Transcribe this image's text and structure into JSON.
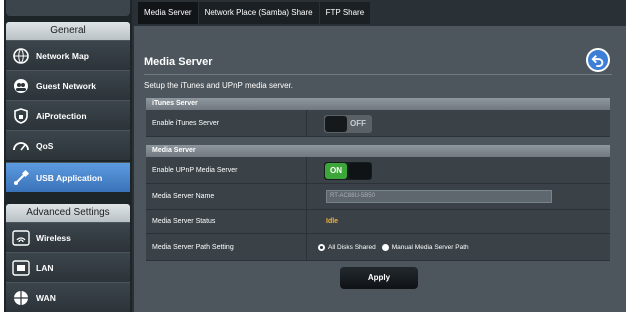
{
  "sidebar": {
    "general_title": "General",
    "advanced_title": "Advanced Settings",
    "items": [
      {
        "label": "Network Map",
        "icon": "network-map-icon"
      },
      {
        "label": "Guest Network",
        "icon": "guest-network-icon"
      },
      {
        "label": "AiProtection",
        "icon": "shield-icon"
      },
      {
        "label": "QoS",
        "icon": "speedometer-icon"
      },
      {
        "label": "USB Application",
        "icon": "usb-icon",
        "active": true
      }
    ],
    "advanced_items": [
      {
        "label": "Wireless",
        "icon": "wireless-icon"
      },
      {
        "label": "LAN",
        "icon": "lan-icon"
      },
      {
        "label": "WAN",
        "icon": "globe-icon"
      }
    ]
  },
  "tabs": [
    "Media Server",
    "Network Place (Samba) Share",
    "FTP Share"
  ],
  "page": {
    "title": "Media Server",
    "subtitle": "Setup the iTunes and UPnP media server."
  },
  "itunes": {
    "header": "iTunes Server",
    "enable_label": "Enable iTunes Server",
    "enable_state": "OFF"
  },
  "media": {
    "header": "Media Server",
    "enable_label": "Enable UPnP Media Server",
    "enable_state": "ON",
    "name_label": "Media Server Name",
    "name_value": "RT-AC88U-5B50",
    "status_label": "Media Server Status",
    "status_value": "Idle",
    "path_label": "Media Server Path Setting",
    "path_option_1": "All Disks Shared",
    "path_option_2": "Manual Media Server Path"
  },
  "apply_label": "Apply",
  "colors": {
    "accent_active": "#4a86cf",
    "status": "#f2b233",
    "toggle_on": "#3da63a"
  }
}
